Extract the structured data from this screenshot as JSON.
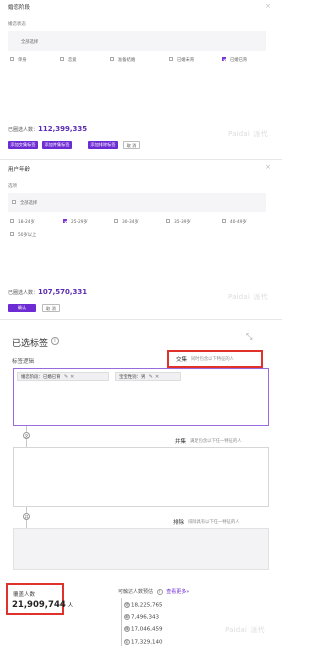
{
  "panel1": {
    "title": "婚恋阶段",
    "group_label": "婚恋状态",
    "select_all": "全部选择",
    "options": [
      {
        "label": "单身",
        "checked": false
      },
      {
        "label": "恋爱",
        "checked": false
      },
      {
        "label": "准备结婚",
        "checked": false
      },
      {
        "label": "已婚未育",
        "checked": false
      },
      {
        "label": "已婚已育",
        "checked": true
      }
    ],
    "count_label": "已圈选人数：",
    "count_value": "112,399,335",
    "buttons": [
      "添加交集标签",
      "添加并集标签",
      "添加排除标签",
      "取 消"
    ]
  },
  "panel2": {
    "title": "用户年龄",
    "group_label": "选项",
    "select_all": "全部选择",
    "options": [
      {
        "label": "18-24岁",
        "checked": false
      },
      {
        "label": "25-29岁",
        "checked": true
      },
      {
        "label": "30-34岁",
        "checked": false
      },
      {
        "label": "35-39岁",
        "checked": false
      },
      {
        "label": "40-49岁",
        "checked": false
      },
      {
        "label": "50岁以上",
        "checked": false
      }
    ],
    "count_label": "已圈选人数：",
    "count_value": "107,570,331",
    "buttons": [
      "确认",
      "取 消"
    ]
  },
  "watermark": {
    "brand": "Paidai",
    "suffix": "派代"
  },
  "selected": {
    "title": "已选标签",
    "logic_label": "标签逻辑",
    "intersection": {
      "title": "交集",
      "hint": "同时包含以下特征的人"
    },
    "union": {
      "title": "并集",
      "hint": "满足包含以下任一特征的人"
    },
    "exclude": {
      "title": "排除",
      "hint": "排除具有以下任一特征的人"
    },
    "tags": [
      {
        "text": "婚恋阶段：已婚已育"
      },
      {
        "text": "宝宝性别：男"
      }
    ],
    "connectors": [
      "交",
      "并"
    ]
  },
  "coverage": {
    "label": "覆盖人数",
    "value": "21,909,744",
    "unit": "人"
  },
  "reach": {
    "label": "可触达人数预估",
    "link": "查看更多",
    "rows": [
      {
        "icon": "短",
        "value": "18,225,765"
      },
      {
        "icon": "邮",
        "value": "7,496,343"
      },
      {
        "icon": "微",
        "value": "17,046,459"
      },
      {
        "icon": "钉",
        "value": "17,329,140"
      }
    ]
  },
  "colors": {
    "accent": "#6d2bd3",
    "highlight": "#e0322a"
  }
}
